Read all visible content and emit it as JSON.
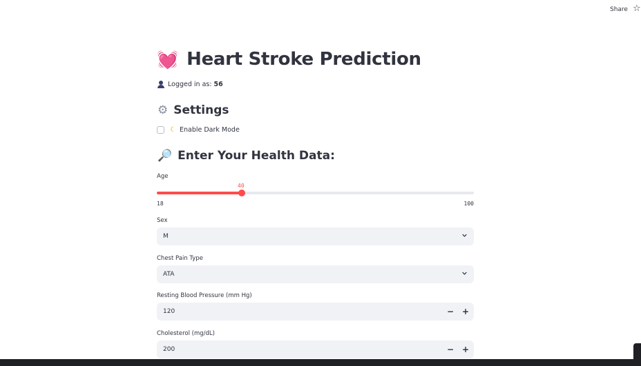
{
  "toolbar": {
    "share_label": "Share",
    "star_icon": "star-icon"
  },
  "header": {
    "title_emoji": "💓",
    "title": "Heart Stroke Prediction"
  },
  "user": {
    "prefix": "Logged in as:",
    "name": "56",
    "icon": "user-icon"
  },
  "settings": {
    "heading": "Settings",
    "icon": "gear-icon",
    "dark_mode": {
      "label": "Enable Dark Mode",
      "checked": false,
      "icon": "moon-icon"
    }
  },
  "form": {
    "heading": "Enter Your Health Data:",
    "icon": "magnifier-icon",
    "age": {
      "label": "Age",
      "value": "40",
      "min": "18",
      "max": "100",
      "fraction": 0.268
    },
    "sex": {
      "label": "Sex",
      "value": "M"
    },
    "chest_pain": {
      "label": "Chest Pain Type",
      "value": "ATA"
    },
    "resting_bp": {
      "label": "Resting Blood Pressure (mm Hg)",
      "value": "120"
    },
    "cholesterol": {
      "label": "Cholesterol (mg/dL)",
      "value": "200"
    },
    "minus": "−",
    "plus": "+"
  },
  "colors": {
    "accent": "#ff4b4b",
    "field_bg": "#f0f2f6",
    "text": "#31333f"
  }
}
